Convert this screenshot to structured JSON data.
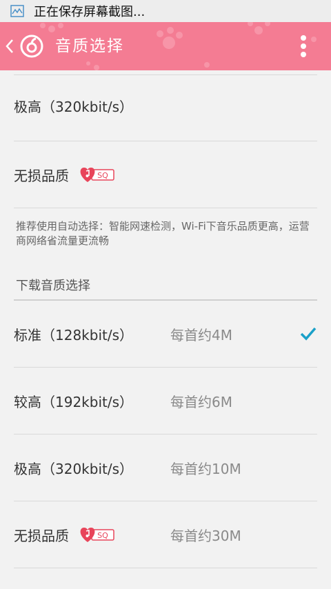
{
  "status_bar": {
    "notification_text": "正在保存屏幕截图..."
  },
  "header": {
    "title": "音质选择",
    "accent_color": "#f47c93",
    "back_icon": "chevron-left-icon",
    "logo_icon": "app-logo-icon",
    "menu_icon": "more-vert-icon"
  },
  "play_quality": [
    {
      "label": "极高（320kbit/s）"
    },
    {
      "label": "无损品质",
      "badge": "SQ"
    }
  ],
  "hint": "推荐使用自动选择：智能网速检测，Wi-Fi下音乐品质更高，运营商网络省流量更流畅",
  "download_section": {
    "title": "下载音质选择",
    "items": [
      {
        "label": "标准（128kbit/s）",
        "size": "每首约4M",
        "selected": true
      },
      {
        "label": "较高（192kbit/s）",
        "size": "每首约6M",
        "selected": false
      },
      {
        "label": "极高（320kbit/s）",
        "size": "每首约10M",
        "selected": false
      },
      {
        "label": "无损品质",
        "badge": "SQ",
        "size": "每首约30M",
        "selected": false
      }
    ]
  },
  "colors": {
    "check": "#1aa0c8",
    "badge": "#e8445a"
  }
}
